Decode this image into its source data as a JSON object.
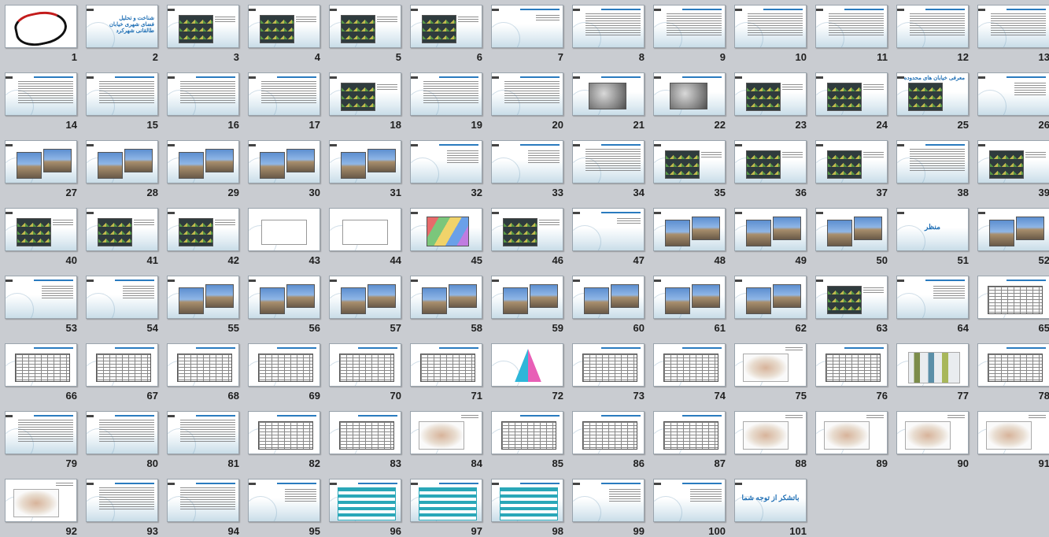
{
  "slides": [
    {
      "num": "1",
      "kind": "logo"
    },
    {
      "num": "2",
      "kind": "text",
      "text": "شناخت و تحلیل فضای شهری خیابان طالقانی شهرکرد"
    },
    {
      "num": "3",
      "kind": "map"
    },
    {
      "num": "4",
      "kind": "map"
    },
    {
      "num": "5",
      "kind": "map"
    },
    {
      "num": "6",
      "kind": "map"
    },
    {
      "num": "7",
      "kind": "title"
    },
    {
      "num": "8",
      "kind": "lines"
    },
    {
      "num": "9",
      "kind": "lines"
    },
    {
      "num": "10",
      "kind": "lines"
    },
    {
      "num": "11",
      "kind": "lines"
    },
    {
      "num": "12",
      "kind": "lines"
    },
    {
      "num": "13",
      "kind": "lines"
    },
    {
      "num": "14",
      "kind": "lines"
    },
    {
      "num": "15",
      "kind": "lines"
    },
    {
      "num": "16",
      "kind": "lines"
    },
    {
      "num": "17",
      "kind": "lines"
    },
    {
      "num": "18",
      "kind": "map"
    },
    {
      "num": "19",
      "kind": "lines"
    },
    {
      "num": "20",
      "kind": "lines"
    },
    {
      "num": "21",
      "kind": "aerial"
    },
    {
      "num": "22",
      "kind": "aerial"
    },
    {
      "num": "23",
      "kind": "map"
    },
    {
      "num": "24",
      "kind": "map"
    },
    {
      "num": "25",
      "kind": "map",
      "text": "معرفی خیابان های محدوده"
    },
    {
      "num": "26",
      "kind": "short"
    },
    {
      "num": "27",
      "kind": "photo"
    },
    {
      "num": "28",
      "kind": "photo"
    },
    {
      "num": "29",
      "kind": "photo"
    },
    {
      "num": "30",
      "kind": "photo"
    },
    {
      "num": "31",
      "kind": "photo"
    },
    {
      "num": "32",
      "kind": "short"
    },
    {
      "num": "33",
      "kind": "short"
    },
    {
      "num": "34",
      "kind": "lines"
    },
    {
      "num": "35",
      "kind": "map"
    },
    {
      "num": "36",
      "kind": "map"
    },
    {
      "num": "37",
      "kind": "map"
    },
    {
      "num": "38",
      "kind": "lines"
    },
    {
      "num": "39",
      "kind": "map"
    },
    {
      "num": "40",
      "kind": "map"
    },
    {
      "num": "41",
      "kind": "map"
    },
    {
      "num": "42",
      "kind": "map"
    },
    {
      "num": "43",
      "kind": "diagram"
    },
    {
      "num": "44",
      "kind": "diagram"
    },
    {
      "num": "45",
      "kind": "colormap"
    },
    {
      "num": "46",
      "kind": "map"
    },
    {
      "num": "47",
      "kind": "title"
    },
    {
      "num": "48",
      "kind": "photo"
    },
    {
      "num": "49",
      "kind": "photo"
    },
    {
      "num": "50",
      "kind": "photo"
    },
    {
      "num": "51",
      "kind": "text",
      "text": "منظر"
    },
    {
      "num": "52",
      "kind": "photo"
    },
    {
      "num": "53",
      "kind": "short"
    },
    {
      "num": "54",
      "kind": "short"
    },
    {
      "num": "55",
      "kind": "photo"
    },
    {
      "num": "56",
      "kind": "photo"
    },
    {
      "num": "57",
      "kind": "photo"
    },
    {
      "num": "58",
      "kind": "photo"
    },
    {
      "num": "59",
      "kind": "photo"
    },
    {
      "num": "60",
      "kind": "photo"
    },
    {
      "num": "61",
      "kind": "photo"
    },
    {
      "num": "62",
      "kind": "photo"
    },
    {
      "num": "63",
      "kind": "map"
    },
    {
      "num": "64",
      "kind": "short"
    },
    {
      "num": "65",
      "kind": "table"
    },
    {
      "num": "66",
      "kind": "table"
    },
    {
      "num": "67",
      "kind": "table"
    },
    {
      "num": "68",
      "kind": "table"
    },
    {
      "num": "69",
      "kind": "table"
    },
    {
      "num": "70",
      "kind": "table"
    },
    {
      "num": "71",
      "kind": "table"
    },
    {
      "num": "72",
      "kind": "pyramid"
    },
    {
      "num": "73",
      "kind": "table"
    },
    {
      "num": "74",
      "kind": "table"
    },
    {
      "num": "75",
      "kind": "city"
    },
    {
      "num": "76",
      "kind": "table"
    },
    {
      "num": "77",
      "kind": "chart3d"
    },
    {
      "num": "78",
      "kind": "table"
    },
    {
      "num": "79",
      "kind": "lines"
    },
    {
      "num": "80",
      "kind": "lines"
    },
    {
      "num": "81",
      "kind": "lines"
    },
    {
      "num": "82",
      "kind": "table"
    },
    {
      "num": "83",
      "kind": "table"
    },
    {
      "num": "84",
      "kind": "city"
    },
    {
      "num": "85",
      "kind": "table"
    },
    {
      "num": "86",
      "kind": "table"
    },
    {
      "num": "87",
      "kind": "table"
    },
    {
      "num": "88",
      "kind": "city"
    },
    {
      "num": "89",
      "kind": "city"
    },
    {
      "num": "90",
      "kind": "city"
    },
    {
      "num": "91",
      "kind": "city"
    },
    {
      "num": "92",
      "kind": "city"
    },
    {
      "num": "93",
      "kind": "lines"
    },
    {
      "num": "94",
      "kind": "lines"
    },
    {
      "num": "95",
      "kind": "short"
    },
    {
      "num": "96",
      "kind": "teal"
    },
    {
      "num": "97",
      "kind": "teal"
    },
    {
      "num": "98",
      "kind": "teal"
    },
    {
      "num": "99",
      "kind": "short"
    },
    {
      "num": "100",
      "kind": "short"
    },
    {
      "num": "101",
      "kind": "text",
      "text": "باتشکر از توجه شما"
    }
  ]
}
